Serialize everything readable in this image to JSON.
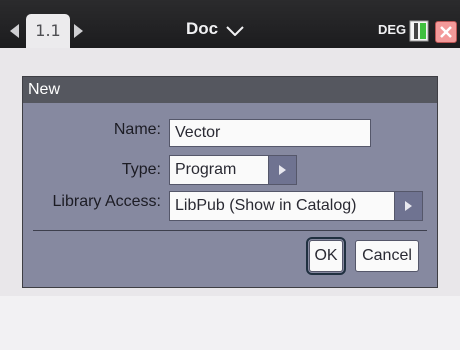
{
  "header": {
    "page_tab": "1.1",
    "doc_title": "Doc",
    "angle_mode": "DEG"
  },
  "dialog": {
    "title": "New",
    "name_label": "Name:",
    "name_value": "Vector",
    "type_label": "Type:",
    "type_value": "Program",
    "library_label": "Library Access:",
    "library_value": "LibPub (Show in Catalog)",
    "ok_label": "OK",
    "cancel_label": "Cancel"
  },
  "icons": {
    "prev_page": "left-arrow-icon",
    "next_page": "right-arrow-icon",
    "doc_menu": "chevron-down-icon",
    "battery": "battery-icon",
    "close": "close-icon"
  },
  "colors": {
    "dialog_bg": "#8689a0",
    "title_bar": "#55575f",
    "close_bg": "#f39a9a"
  }
}
